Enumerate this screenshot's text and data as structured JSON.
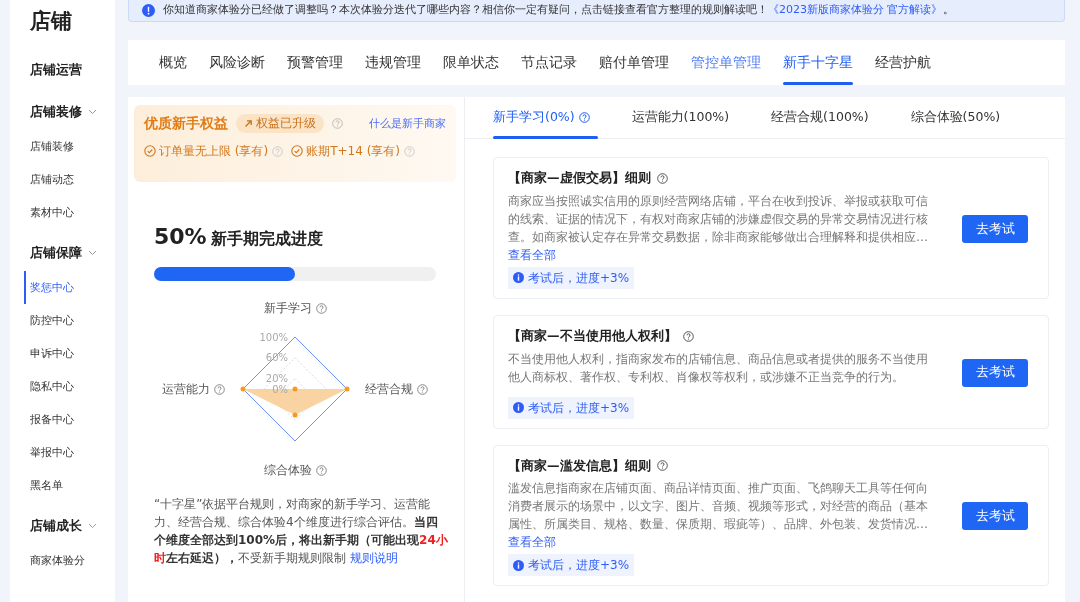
{
  "sidebar": {
    "title": "店铺",
    "items": [
      {
        "label": "店铺运营",
        "kind": "heading"
      },
      {
        "label": "店铺装修",
        "kind": "group",
        "expanded": true
      },
      {
        "label": "店铺装修",
        "kind": "link",
        "selected": false
      },
      {
        "label": "店铺动态",
        "kind": "link",
        "selected": false
      },
      {
        "label": "素材中心",
        "kind": "link",
        "selected": false
      },
      {
        "label": "店铺保障",
        "kind": "group",
        "expanded": true
      },
      {
        "label": "奖惩中心",
        "kind": "link",
        "selected": true
      },
      {
        "label": "防控中心",
        "kind": "link",
        "selected": false
      },
      {
        "label": "申诉中心",
        "kind": "link",
        "selected": false
      },
      {
        "label": "隐私中心",
        "kind": "link",
        "selected": false
      },
      {
        "label": "报备中心",
        "kind": "link",
        "selected": false
      },
      {
        "label": "举报中心",
        "kind": "link",
        "selected": false
      },
      {
        "label": "黑名单",
        "kind": "link",
        "selected": false
      },
      {
        "label": "店铺成长",
        "kind": "group",
        "expanded": true
      },
      {
        "label": "商家体验分",
        "kind": "link",
        "selected": false
      }
    ]
  },
  "notice": {
    "text": "你知道商家体验分已经做了调整吗？本次体验分迭代了哪些内容？相信你一定有疑问，点击链接查看官方整理的规则解读吧！",
    "link": "《2023新版商家体验分 官方解读》",
    "end": "。"
  },
  "tabs": [
    {
      "label": "概览",
      "selected": false,
      "hovered": false
    },
    {
      "label": "风险诊断",
      "selected": false,
      "hovered": false
    },
    {
      "label": "预警管理",
      "selected": false,
      "hovered": false
    },
    {
      "label": "违规管理",
      "selected": false,
      "hovered": false
    },
    {
      "label": "限单状态",
      "selected": false,
      "hovered": false
    },
    {
      "label": "节点记录",
      "selected": false,
      "hovered": false
    },
    {
      "label": "赔付单管理",
      "selected": false,
      "hovered": false
    },
    {
      "label": "管控单管理",
      "selected": false,
      "hovered": true
    },
    {
      "label": "新手十字星",
      "selected": true,
      "hovered": false
    },
    {
      "label": "经营护航",
      "selected": false,
      "hovered": false
    }
  ],
  "benefits": {
    "title": "优质新手权益",
    "badge": "权益已升级",
    "link": "什么是新手商家",
    "items": [
      "订单量无上限 (享有)",
      "账期T+14 (享有)"
    ]
  },
  "progress": {
    "percent": "50%",
    "label": "新手期完成进度",
    "level": 0.5
  },
  "radar": {
    "chart_data": {
      "type": "radar",
      "categories": [
        "新手学习",
        "经营合规",
        "综合体验",
        "运营能力"
      ],
      "values": [
        0,
        100,
        50,
        100
      ],
      "ylim": [
        0,
        100
      ],
      "yticks": [
        {
          "value": 0,
          "label": "0%"
        },
        {
          "value": 20,
          "label": "20%"
        },
        {
          "value": 60,
          "label": "60%"
        },
        {
          "value": 100,
          "label": "100%"
        }
      ]
    }
  },
  "description": [
    {
      "kind": "plain",
      "text": "“十字星”依据平台规则，对商家的新手学习、运营能力、经营合规、综合体验4个维度进行综合评估。"
    },
    {
      "kind": "bold",
      "text": "当四个维度全部达到100%后，将出新手期（可能出现"
    },
    {
      "kind": "alert",
      "text": "24小时"
    },
    {
      "kind": "bold",
      "text": "左右延迟），"
    },
    {
      "kind": "plain",
      "text": "不受新手期规则限制 "
    },
    {
      "kind": "link",
      "text": "规则说明"
    }
  ],
  "subtabs": [
    {
      "label": "新手学习(0%)",
      "selected": true,
      "help": true
    },
    {
      "label": "运营能力(100%)",
      "selected": false,
      "help": false
    },
    {
      "label": "经营合规(100%)",
      "selected": false,
      "help": false
    },
    {
      "label": "综合体验(50%)",
      "selected": false,
      "help": false
    }
  ],
  "rules": [
    {
      "title": "【商家—虚假交易】细则",
      "text": "商家应当按照诚实信用的原则经营网络店铺，平台在收到投诉、举报或获取可信的线索、证据的情况下，有权对商家店铺的涉嫌虚假交易的异常交易情况进行核查。如商家被认定存在异常交易数据，除非商家能够做出合理解释和提供相应…",
      "more": "查看全部",
      "tip": "考试后，进度+3%",
      "button": "去考试"
    },
    {
      "title": "【商家—不当使用他人权利】",
      "text": "不当使用他人权利，指商家发布的店铺信息、商品信息或者提供的服务不当使用他人商标权、著作权、专利权、肖像权等权利，或涉嫌不正当竞争的行为。",
      "tip": "考试后，进度+3%",
      "button": "去考试"
    },
    {
      "title": "【商家—滥发信息】细则",
      "text": "滥发信息指商家在店铺页面、商品详情页面、推广页面、飞鸽聊天工具等任何向消费者展示的场景中，以文字、图片、音频、视频等形式，对经营的商品（基本属性、所属类目、规格、数量、保质期、瑕疵等）、品牌、外包装、发货情况…",
      "more": "查看全部",
      "tip": "考试后，进度+3%",
      "button": "去考试"
    }
  ]
}
